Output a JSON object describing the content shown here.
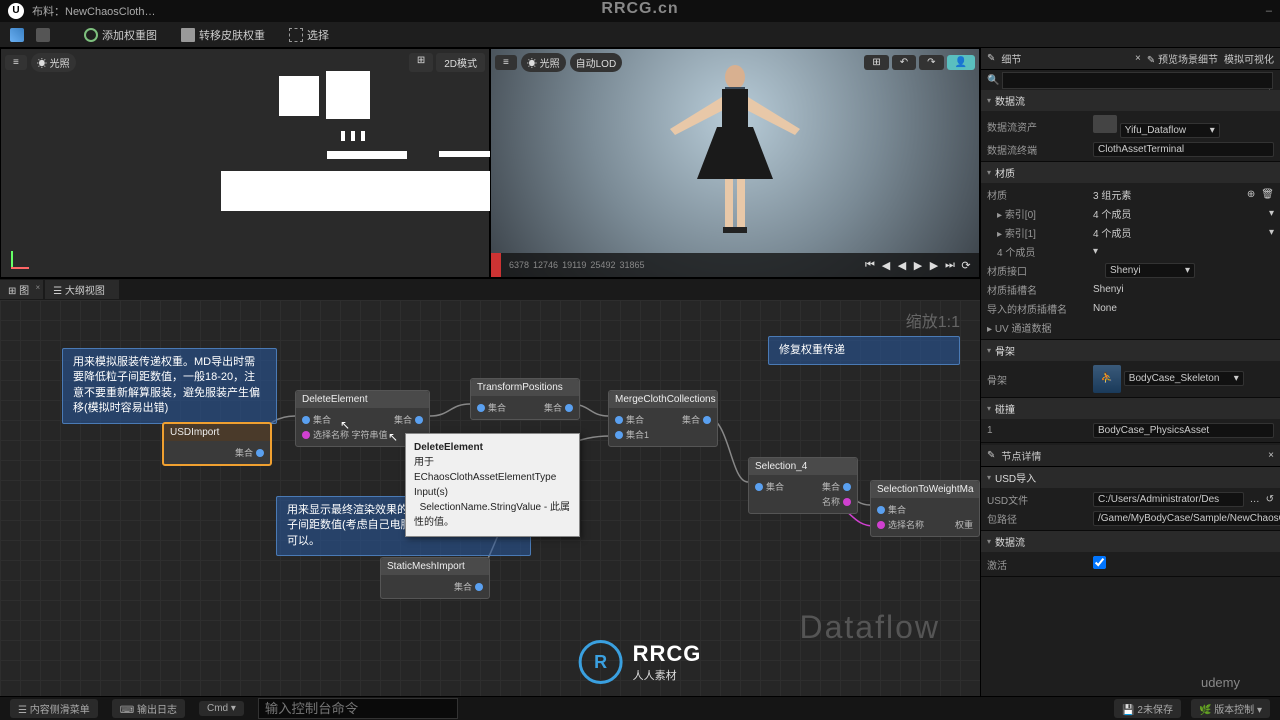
{
  "watermark": {
    "top": "RRCG.cn",
    "center": "RRCG",
    "center_sub": "人人素材",
    "udemy": "udemy"
  },
  "titlebar": {
    "icon_label": "U",
    "title": "布料：NewChaosCloth…",
    "minimize": "–"
  },
  "toolbar": {
    "add_weight": "添加权重图",
    "transfer": "转移皮肤权重",
    "select": "选择"
  },
  "viewport2d": {
    "menu": "≡",
    "lit": "光照",
    "mode": "2D模式",
    "sim": "⏵"
  },
  "viewport3d": {
    "menu": "≡",
    "lit": "光照",
    "autolod": "自动LOD",
    "frames": [
      "6378",
      "12746",
      "19119",
      "25492",
      "31865"
    ]
  },
  "tabs": {
    "graph": "图",
    "outliner": "大纲视图"
  },
  "zoom_label": "缩放1:1",
  "dataflow": "Dataflow",
  "comment1": "用来模拟服装传递权重。MD导出时需要降低粒子间距数值，一般18-20，注意不要重新解算服装，避免服装产生偏移(模拟时容易出错)",
  "comment2": "用来显示最终渲染效果的服装。建议可以增加粒子间距数值(考虑自己电脑性能)，建议增厚度都可以。",
  "comment3": "修复权重传递",
  "nodes": {
    "usdimport": {
      "title": "USDImport",
      "port": "集合"
    },
    "delete": {
      "title": "DeleteElement",
      "p_in": "集合",
      "p_out": "集合",
      "p_str": "选择名称 字符串值"
    },
    "transform": {
      "title": "TransformPositions",
      "p_in": "集合",
      "p_out": "集合"
    },
    "merge": {
      "title": "MergeClothCollections",
      "p_in": "集合",
      "p_out": "集合",
      "p_in2": "集合1"
    },
    "sel4": {
      "title": "Selection_4",
      "p_in": "集合",
      "p_out": "集合",
      "p_name": "名称"
    },
    "s2w": {
      "title": "SelectionToWeightMa",
      "p_in": "集合",
      "p_name": "选择名称",
      "p_out": "权重"
    },
    "static": {
      "title": "StaticMeshImport",
      "p_out": "集合"
    }
  },
  "tooltip": {
    "title": "DeleteElement",
    "desc": "用于EChaosClothAssetElementType",
    "inputs": "Input(s)",
    "line": "SelectionName.StringValue - 此属性的值。"
  },
  "right": {
    "tab1": "细节",
    "tab2": "预览场景细节",
    "tab3": "模拟可视化",
    "search_ph": "",
    "sec_dataflow": "数据流",
    "prop_asset": "数据流资产",
    "asset_value": "Yifu_Dataflow",
    "prop_terminal": "数据流终端",
    "terminal_value": "ClothAssetTerminal",
    "sec_material": "材质",
    "mat_slot": "材质",
    "mat_elems": "3 组元素",
    "mat_idx0": "索引[0]",
    "mat_idx1": "索引[1]",
    "mat_idx_val": "4 个成员",
    "mat_slot_lbl": "材质接口",
    "mat_value": "Shenyi",
    "mat_slot_name": "材质插槽名",
    "mat_slot_val": "Shenyi",
    "mat_imported": "导入的材质插槽名",
    "mat_imported_val": "None",
    "mat_uv": "UV 通道数据",
    "sec_skeleton": "骨架",
    "skel_lbl": "骨架",
    "skel_val": "BodyCase_Skeleton",
    "sec_collision": "碰撞",
    "coll_val": "BodyCase_PhysicsAsset",
    "tab_det": "节点详情",
    "usd_head": "USD导入",
    "usd_file": "USD文件",
    "usd_path": "C:/Users/Administrator/Des",
    "pkg_path": "包路径",
    "pkg_val": "/Game/MyBodyCase/Sample/NewChaosClo",
    "sec_dataflow2": "数据流",
    "activate": "激活"
  },
  "bottom": {
    "content": "内容侧滑菜单",
    "output": "输出日志",
    "cmd": "Cmd ▾",
    "cmd_ph": "输入控制台命令",
    "unsaved": "2未保存",
    "version": "版本控制"
  }
}
